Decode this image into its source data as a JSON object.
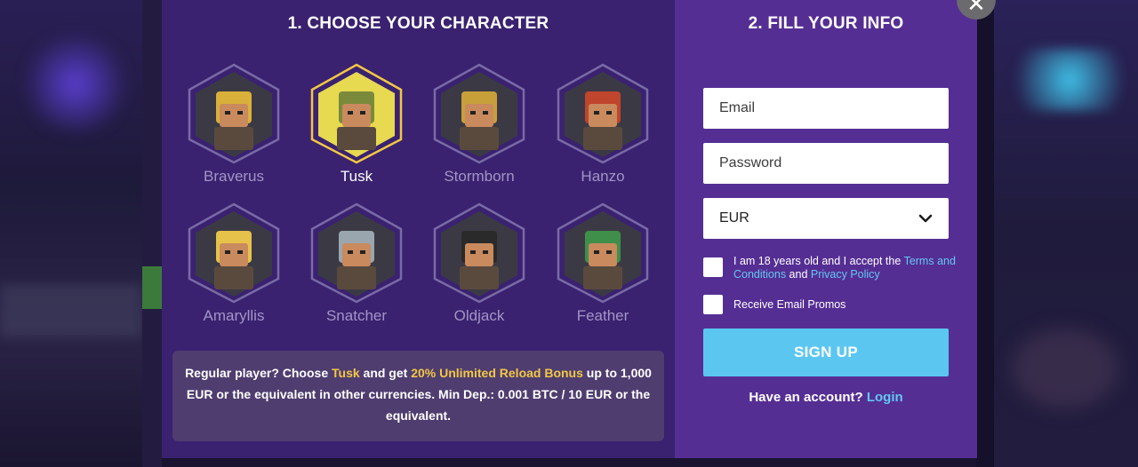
{
  "left": {
    "title": "1. CHOOSE YOUR CHARACTER",
    "characters": [
      {
        "name": "Braverus",
        "selected": false,
        "accent": "#d9b03a"
      },
      {
        "name": "Tusk",
        "selected": true,
        "accent": "#7a8a3a"
      },
      {
        "name": "Stormborn",
        "selected": false,
        "accent": "#c8a03a"
      },
      {
        "name": "Hanzo",
        "selected": false,
        "accent": "#c0452d"
      },
      {
        "name": "Amaryllis",
        "selected": false,
        "accent": "#e6c24a"
      },
      {
        "name": "Snatcher",
        "selected": false,
        "accent": "#9aa6ae"
      },
      {
        "name": "Oldjack",
        "selected": false,
        "accent": "#2a2a2a"
      },
      {
        "name": "Feather",
        "selected": false,
        "accent": "#3f8f4a"
      }
    ],
    "promo": {
      "part1": "Regular player? Choose ",
      "hl1": "Tusk",
      "part2": " and get ",
      "hl2": "20% Unlimited Reload Bonus",
      "part3": " up to 1,000 EUR or the equivalent in other currencies. Min Dep.: 0.001 BTC / 10 EUR or the equivalent."
    }
  },
  "right": {
    "title": "2. FILL YOUR INFO",
    "email_placeholder": "Email",
    "password_placeholder": "Password",
    "currency_value": "EUR",
    "terms": {
      "prefix": "I am 18 years old and I accept the ",
      "terms_link": "Terms and Conditions",
      "and": " and ",
      "privacy_link": "Privacy Policy"
    },
    "promos_label": "Receive Email Promos",
    "signup_label": "SIGN UP",
    "have_account": "Have an account? ",
    "login_link": "Login"
  },
  "close_label": "✕",
  "colors": {
    "left_panel": "#3a2270",
    "right_panel": "#552e94",
    "highlight": "#f2c744",
    "link": "#63c7f2",
    "button": "#5bc7f1",
    "selected_hex": "#f2c744",
    "default_hex": "#7a6aa6"
  }
}
